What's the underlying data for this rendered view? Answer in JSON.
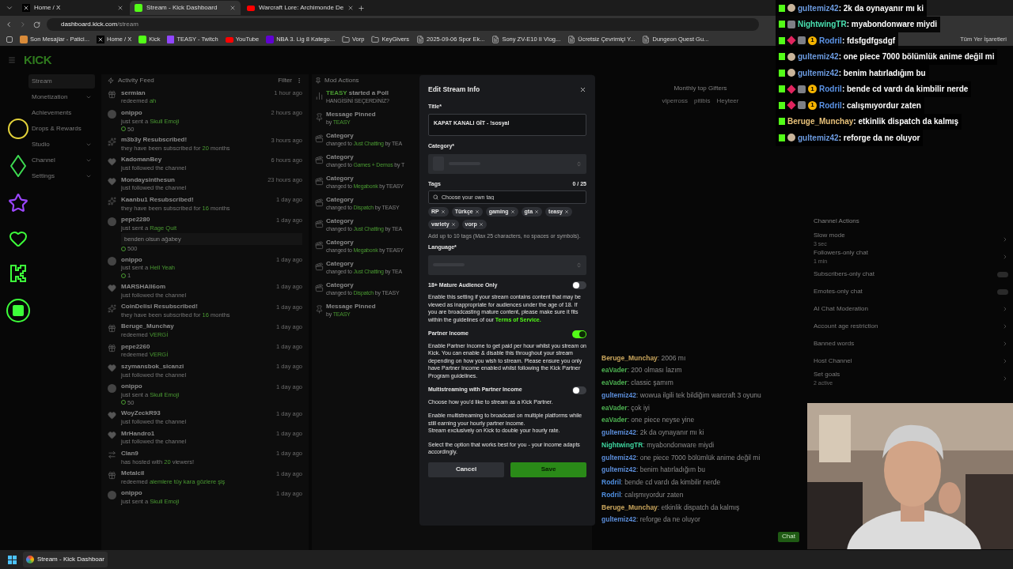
{
  "browser": {
    "tabs": [
      {
        "kind": "x",
        "title": "Home / X",
        "selected": false
      },
      {
        "kind": "kick",
        "title": "Stream - Kick Dashboard",
        "selected": true
      },
      {
        "kind": "youtube",
        "title": "Warcraft Lore: Archimonde De",
        "selected": false
      }
    ],
    "url": {
      "host": "dashboard.kick.com",
      "path": "/stream"
    },
    "bookmarks": [
      {
        "kind": "cat",
        "label": "Son Mesajlar - Patici..."
      },
      {
        "kind": "x",
        "label": "Home / X"
      },
      {
        "kind": "kick",
        "label": "Kick"
      },
      {
        "kind": "twitch",
        "label": "TEASY - Twitch"
      },
      {
        "kind": "youtube",
        "label": "YouTube"
      },
      {
        "kind": "yahoo",
        "label": "NBA 3. Lig 8 Katego..."
      },
      {
        "kind": "folder",
        "label": "Vorp"
      },
      {
        "kind": "folder",
        "label": "KeyGivers"
      },
      {
        "kind": "page",
        "label": "2025-09-06 Spor Ek..."
      },
      {
        "kind": "page",
        "label": "Sony ZV-E10 II Vlog..."
      },
      {
        "kind": "page",
        "label": "Ücretsiz Çevrimiçi Y..."
      },
      {
        "kind": "page",
        "label": "Dungeon Quest Gu..."
      }
    ],
    "all_bookmarks": "Tüm Yer İşaretleri"
  },
  "logo": "KICK",
  "sidebar": [
    {
      "label": "Stream",
      "expandable": false,
      "selected": true
    },
    {
      "label": "Monetization",
      "expandable": true,
      "selected": false
    },
    {
      "label": "Achievements",
      "expandable": false,
      "selected": false
    },
    {
      "label": "Drops & Rewards",
      "expandable": false,
      "selected": false
    },
    {
      "label": "Studio",
      "expandable": true,
      "selected": false
    },
    {
      "label": "Channel",
      "expandable": true,
      "selected": false
    },
    {
      "label": "Settings",
      "expandable": true,
      "selected": false
    }
  ],
  "activity_feed": {
    "title": "Activity Feed",
    "filter": "Filter",
    "items": [
      {
        "kind": "redeem",
        "name": "sermian",
        "pre": "redeemed",
        "hi": "ah",
        "time": "1 hour ago"
      },
      {
        "kind": "kicks",
        "name": "onippo",
        "pre": "just sent a",
        "hi": "Skull Emoji",
        "amount": "50",
        "time": "2 hours ago"
      },
      {
        "kind": "sub",
        "name": "m3b3y Resubscribed!",
        "pre": "they have been subscribed for",
        "hi": "20",
        "post": "months",
        "time": "3 hours ago"
      },
      {
        "kind": "follow",
        "name": "KadomanBey",
        "pre": "just followed the channel",
        "time": "6 hours ago"
      },
      {
        "kind": "follow",
        "name": "Mondaysinthesun",
        "pre": "just followed the channel",
        "time": "23 hours ago"
      },
      {
        "kind": "sub",
        "name": "Kaanbu1 Resubscribed!",
        "pre": "they have been subscribed for",
        "hi": "16",
        "post": "months",
        "time": "1 day ago"
      },
      {
        "kind": "kicks",
        "name": "pepe2280",
        "pre": "just sent a",
        "hi": "Rage Quit",
        "message": "benden olsun ağabey",
        "amount": "500",
        "time": "1 day ago"
      },
      {
        "kind": "kicks",
        "name": "onippo",
        "pre": "just sent a",
        "hi": "Hell Yeah",
        "amount": "1",
        "time": "1 day ago"
      },
      {
        "kind": "follow",
        "name": "MARSHAll6om",
        "pre": "just followed the channel",
        "time": "1 day ago"
      },
      {
        "kind": "sub",
        "name": "CoinDelisi Resubscribed!",
        "pre": "they have been subscribed for",
        "hi": "16",
        "post": "months",
        "time": "1 day ago"
      },
      {
        "kind": "redeem",
        "name": "Beruge_Munchay",
        "pre": "redeemed",
        "hi": "VERGİ",
        "time": "1 day ago"
      },
      {
        "kind": "redeem",
        "name": "pepe2260",
        "pre": "redeemed",
        "hi": "VERGİ",
        "time": "1 day ago"
      },
      {
        "kind": "follow",
        "name": "szymansbok_sicanzi",
        "pre": "just followed the channel",
        "time": "1 day ago"
      },
      {
        "kind": "kicks",
        "name": "onippo",
        "pre": "just sent a",
        "hi": "Skull Emoji",
        "amount": "50",
        "time": "1 day ago"
      },
      {
        "kind": "follow",
        "name": "WoyZeckR93",
        "pre": "just followed the channel",
        "time": "1 day ago"
      },
      {
        "kind": "follow",
        "name": "MrHandro1",
        "pre": "just followed the channel",
        "time": "1 day ago"
      },
      {
        "kind": "host",
        "name": "Clan9",
        "pre": "has hosted with",
        "hi": "20",
        "post": "viewers!",
        "time": "1 day ago"
      },
      {
        "kind": "redeem",
        "name": "Metalcil",
        "pre": "redeemed",
        "hi": "alemlere tüy kara gözlere şiş",
        "time": "1 day ago"
      },
      {
        "kind": "kicks",
        "name": "onippo",
        "pre": "just sent a",
        "hi": "Skull Emoji",
        "time": "1 day ago"
      }
    ]
  },
  "mod_actions": {
    "title": "Mod Actions",
    "items": [
      {
        "kind": "poll",
        "title": "started a Poll",
        "who": "TEASY",
        "pre": "HANGİSİNİ SEÇERDİNİZ?"
      },
      {
        "kind": "pin",
        "title": "Message Pinned",
        "pre": "by",
        "hi": "TEASY"
      },
      {
        "kind": "category",
        "title": "Category",
        "pre": "changed to",
        "hi": "Just Chatting",
        "post": "by TEA"
      },
      {
        "kind": "category",
        "title": "Category",
        "pre": "changed to",
        "hi": "Games + Demos",
        "post": "by T"
      },
      {
        "kind": "category",
        "title": "Category",
        "pre": "changed to",
        "hi": "Megabonk",
        "post": "by TEASY"
      },
      {
        "kind": "category",
        "title": "Category",
        "pre": "changed to",
        "hi": "Dispatch",
        "post": "by TEASY"
      },
      {
        "kind": "category",
        "title": "Category",
        "pre": "changed to",
        "hi": "Just Chatting",
        "post": "by TEA"
      },
      {
        "kind": "category",
        "title": "Category",
        "pre": "changed to",
        "hi": "Megabonk",
        "post": "by TEASY"
      },
      {
        "kind": "category",
        "title": "Category",
        "pre": "changed to",
        "hi": "Just Chatting",
        "post": "by TEA"
      },
      {
        "kind": "category",
        "title": "Category",
        "pre": "changed to",
        "hi": "Dispatch",
        "post": "by TEASY"
      },
      {
        "kind": "pin",
        "title": "Message Pinned",
        "pre": "by",
        "hi": "TEASY"
      }
    ]
  },
  "gifters": {
    "title": "Monthly top Gifters",
    "names": [
      "viperross",
      "pitibis",
      "Heyteer"
    ]
  },
  "stream_chat": {
    "lines": [
      {
        "user": "Beruge_Munchay",
        "color": "#c9a55c",
        "text": ": 2006 mı"
      },
      {
        "user": "eaVader",
        "color": "#4caf50",
        "text": ": 200 olması lazım"
      },
      {
        "user": "eaVader",
        "color": "#4caf50",
        "text": ": classic şamım"
      },
      {
        "user": "gultemiz42",
        "color": "#5b8dd9",
        "text": ": wowua ilgili tek bildiğim warcraft 3 oyunu"
      },
      {
        "user": "eaVader",
        "color": "#4caf50",
        "text": ": çok iyi"
      },
      {
        "user": "eaVader",
        "color": "#4caf50",
        "text": ": one piece neyse yine"
      },
      {
        "user": "gultemiz42",
        "color": "#5b8dd9",
        "text": ": 2k da oynayanır mı ki"
      },
      {
        "user": "NightwingTR",
        "color": "#3fd7a0",
        "text": ": myabondonware miydi"
      },
      {
        "user": "gultemiz42",
        "color": "#5b8dd9",
        "text": ": one piece 7000 bölümlük anime değil mi"
      },
      {
        "user": "gultemiz42",
        "color": "#5b8dd9",
        "text": ": benim hatırladığım bu"
      },
      {
        "user": "Rodril",
        "color": "#4f8fe0",
        "text": ": bende cd vardı da kimbilir nerde"
      },
      {
        "user": "Rodril",
        "color": "#4f8fe0",
        "text": ": calışmıyordur zaten"
      },
      {
        "user": "Beruge_Munchay",
        "color": "#c9a55c",
        "text": ": etkinlik dispatch da kalmış"
      },
      {
        "user": "gultemiz42",
        "color": "#5b8dd9",
        "text": ": reforge da ne oluyor"
      }
    ],
    "chat_button": "Chat"
  },
  "channel_actions": {
    "title": "Channel Actions",
    "items": [
      {
        "kind": "link",
        "label": "Slow mode",
        "sub": "3 sec"
      },
      {
        "kind": "link",
        "label": "Followers-only chat",
        "sub": "1 min"
      },
      {
        "kind": "toggle",
        "label": "Subscribers-only chat",
        "on": false
      },
      {
        "kind": "toggle",
        "label": "Emotes-only chat",
        "on": false
      },
      {
        "kind": "link",
        "label": "AI Chat Moderation"
      },
      {
        "kind": "link",
        "label": "Account age restriction"
      },
      {
        "kind": "link",
        "label": "Banned words"
      },
      {
        "kind": "link",
        "label": "Host Channel"
      },
      {
        "kind": "link",
        "label": "Set goals",
        "sub": "2 active"
      }
    ]
  },
  "modal": {
    "title": "Edit Stream Info",
    "title_label": "Title*",
    "title_value": "KAPAT KANALI GİT - !sosyal",
    "category_label": "Category*",
    "tags_label": "Tags",
    "tags_count": "0 / 25",
    "tags_placeholder": "Choose your own tag",
    "tags": [
      "RP",
      "Türkçe",
      "gaming",
      "gta",
      "teasy",
      "variety",
      "vorp"
    ],
    "tags_hint": "Add up to 10 tags (Max 25 characters, no spaces or symbols).",
    "language_label": "Language*",
    "settings": [
      {
        "label": "18+ Mature Audience Only",
        "on": false,
        "text": "Enable this setting if your stream contains content that may be viewed as inappropriate for audiences under the age of 18. If you are broadcasting mature content, please make sure it fits within the guidelines of our",
        "link": "Terms of Service."
      },
      {
        "label": "Partner Income",
        "on": true,
        "text": "Enable Partner Income to get paid per hour whilst you stream on Kick. You can enable & disable this throughout your stream depending on how you wish to stream. Please ensure you only have Partner Income enabled whilst following the Kick Partner Program guidelines."
      },
      {
        "label": "Multistreaming with Partner Income",
        "on": false,
        "text": "Choose how you'd like to stream as a Kick Partner."
      }
    ],
    "paragraphs": [
      "Enable multistreaming to broadcast on multiple platforms while still earning your hourly partner income.",
      "Stream exclusively on Kick to double your hourly rate.",
      "Select the option that works best for you - your income adapts accordingly."
    ],
    "cancel": "Cancel",
    "save": "Save"
  },
  "chat_overlay": [
    {
      "user": "gultemiz42",
      "color": "#6c9be0",
      "text": ": 2k da oynayanır mı ki",
      "badges": [
        {
          "kind": "avatar"
        }
      ]
    },
    {
      "user": "NightwingTR",
      "color": "#49e0b0",
      "text": ": myabondonware miydi",
      "badges": [
        {
          "kind": "bot"
        }
      ]
    },
    {
      "user": "Rodril",
      "color": "#5b93e6",
      "text": ": fdsfgdfgsdgf",
      "badges": [
        {
          "kind": "gem"
        },
        {
          "kind": "bot"
        }
      ],
      "sub": "1"
    },
    {
      "user": "gultemiz42",
      "color": "#6c9be0",
      "text": ": one piece 7000 bölümlük anime değil mi",
      "badges": [
        {
          "kind": "avatar"
        }
      ]
    },
    {
      "user": "gultemiz42",
      "color": "#6c9be0",
      "text": ": benim hatırladığım bu",
      "badges": [
        {
          "kind": "avatar"
        }
      ]
    },
    {
      "user": "Rodril",
      "color": "#5b93e6",
      "text": ": bende cd vardı da kimbilir nerde",
      "badges": [
        {
          "kind": "gem"
        },
        {
          "kind": "bot"
        }
      ],
      "sub": "1"
    },
    {
      "user": "Rodril",
      "color": "#5b93e6",
      "text": ": calışmıyordur zaten",
      "badges": [
        {
          "kind": "gem"
        },
        {
          "kind": "bot"
        }
      ],
      "sub": "1"
    },
    {
      "user": "Beruge_Munchay",
      "color": "#e8c27a",
      "text": ": etkinlik dispatch da kalmış"
    },
    {
      "user": "gultemiz42",
      "color": "#6c9be0",
      "text": ": reforge da ne oluyor",
      "badges": [
        {
          "kind": "avatar"
        }
      ]
    }
  ],
  "taskbar": {
    "app": "Stream - Kick Dashboar"
  }
}
